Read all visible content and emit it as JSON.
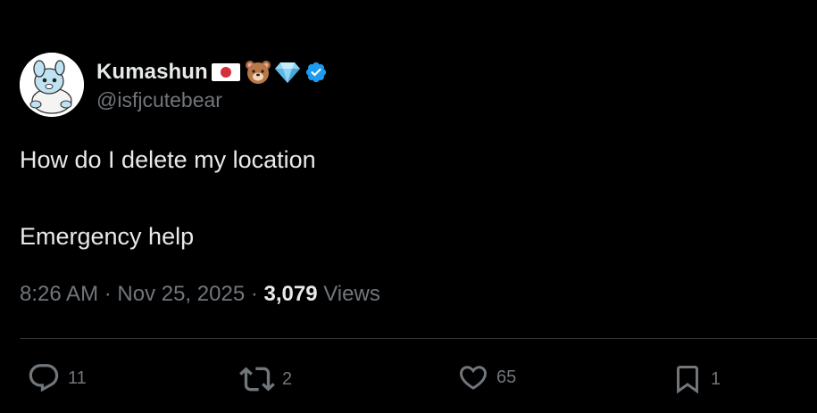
{
  "author": {
    "display_name": "Kumashun",
    "handle": "@isfjcutebear",
    "badges": [
      "japan-flag-icon",
      "bear-face-icon",
      "gem-icon",
      "verified-badge-icon"
    ],
    "avatar": "avatar"
  },
  "tweet": {
    "lines": [
      "How do I delete my location",
      "Emergency help"
    ]
  },
  "meta": {
    "time": "8:26 AM",
    "separator": " · ",
    "date": "Nov 25, 2025",
    "views_count": "3,079",
    "views_label": " Views"
  },
  "actions": {
    "replies": "11",
    "reposts": "2",
    "likes": "65",
    "bookmarks": "1"
  },
  "colors": {
    "background": "#000000",
    "text": "#e7e9ea",
    "secondary": "#71767b",
    "verified": "#1d9bf0",
    "divider": "#2f3336"
  }
}
